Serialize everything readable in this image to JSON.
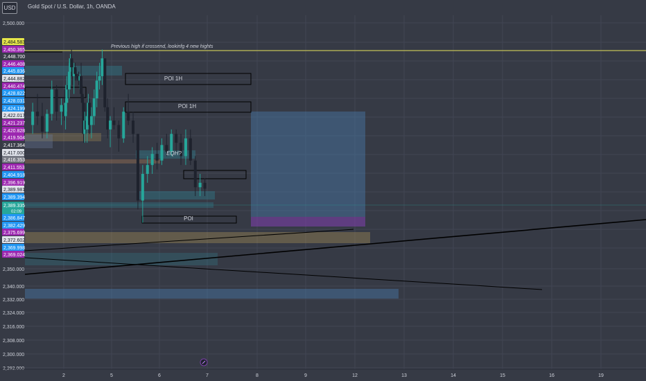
{
  "header": {
    "currency_button": "USD",
    "symbol_title": "Gold Spot / U.S. Dollar, 1h, OANDA"
  },
  "colors": {
    "background": "#363a45",
    "grid": "#414553",
    "candle_up": "#26a69a",
    "candle_down": "#1e222d",
    "hline": "#e5e15a",
    "axis_text": "#d1d4dc"
  },
  "chart_data": {
    "type": "candlestick",
    "symbol": "Gold Spot / U.S. Dollar",
    "interval": "1h",
    "source": "OANDA",
    "grid": true,
    "ylim": [
      2290,
      2506
    ],
    "y_ticks": [
      "2,500.000",
      "2,350.000",
      "2,340.000",
      "2,332.000",
      "2,324.000",
      "2,316.000",
      "2,308.000",
      "2,300.000",
      "2,292.000"
    ],
    "x_ticks": [
      "2",
      "5",
      "6",
      "7",
      "8",
      "9",
      "12",
      "13",
      "14",
      "15",
      "16",
      "19"
    ],
    "price_labels": [
      {
        "text": "2,484.583",
        "price": 2484.583,
        "color": "#e6e64a",
        "dark": true
      },
      {
        "text": "2,450.365",
        "price": 2450.365,
        "color": "#9c27b0"
      },
      {
        "text": "2,448.700",
        "price": 2448.7,
        "color": "#3a3e4a"
      },
      {
        "text": "2,446.408",
        "price": 2446.408,
        "color": "#9c27b0"
      },
      {
        "text": "2,445.836",
        "price": 2445.836,
        "color": "#2196f3"
      },
      {
        "text": "2,444.882",
        "price": 2444.882,
        "color": "#e0e3eb",
        "dark": true
      },
      {
        "text": "2,440.474",
        "price": 2440.474,
        "color": "#9c27b0"
      },
      {
        "text": "2,428.822",
        "price": 2428.822,
        "color": "#2196f3"
      },
      {
        "text": "2,428.031",
        "price": 2428.031,
        "color": "#2196f3"
      },
      {
        "text": "2,424.199",
        "price": 2424.199,
        "color": "#2196f3"
      },
      {
        "text": "2,422.017",
        "price": 2422.017,
        "color": "#e0e3eb",
        "dark": true
      },
      {
        "text": "2,421.237",
        "price": 2421.237,
        "color": "#9c27b0"
      },
      {
        "text": "2,420.828",
        "price": 2420.828,
        "color": "#9c27b0"
      },
      {
        "text": "2,419.504",
        "price": 2419.504,
        "color": "#9c27b0"
      },
      {
        "text": "2,417.364",
        "price": 2417.364,
        "color": "#3a3e4a"
      },
      {
        "text": "2,417.000",
        "price": 2417.0,
        "color": "#e0e3eb",
        "dark": true
      },
      {
        "text": "2,416.353",
        "price": 2416.353,
        "color": "#787b86"
      },
      {
        "text": "2,411.553",
        "price": 2411.553,
        "color": "#9c27b0"
      },
      {
        "text": "2,404.918",
        "price": 2404.918,
        "color": "#2196f3"
      },
      {
        "text": "2,396.919",
        "price": 2396.919,
        "color": "#9c27b0"
      },
      {
        "text": "2,389.981",
        "price": 2389.981,
        "color": "#e0e3eb",
        "dark": true
      },
      {
        "text": "2,389.394",
        "price": 2389.394,
        "color": "#2196f3"
      },
      {
        "text": "2,389.335",
        "price": 2389.335,
        "color": "#26a69a",
        "sub": "02:09"
      },
      {
        "text": "2,386.847",
        "price": 2386.847,
        "color": "#2196f3"
      },
      {
        "text": "2,382.429",
        "price": 2382.429,
        "color": "#2196f3"
      },
      {
        "text": "2,375.699",
        "price": 2375.699,
        "color": "#9c27b0"
      },
      {
        "text": "2,372.602",
        "price": 2372.602,
        "color": "#e0e3eb",
        "dark": true
      },
      {
        "text": "2,369.998",
        "price": 2369.998,
        "color": "#2196f3"
      },
      {
        "text": "2,369.024",
        "price": 2369.024,
        "color": "#9c27b0"
      }
    ],
    "annotations": [
      {
        "text": "Previous high if crossend, lookinfg 4 new hights",
        "price": 2469,
        "x_day": 5.0
      },
      {
        "text": "POI 1H",
        "price": 2443,
        "x_day": 6.1
      },
      {
        "text": "POI 1H",
        "price": 2426,
        "x_day": 6.5
      },
      {
        "text": "EQH?",
        "price": 2417,
        "x_day": 6.3
      },
      {
        "text": "POI",
        "price": 2386,
        "x_day": 6.6
      }
    ],
    "candles": [
      {
        "day": 1.35,
        "o": 2418,
        "h": 2428,
        "l": 2414,
        "c": 2424
      },
      {
        "day": 1.45,
        "o": 2424,
        "h": 2432,
        "l": 2418,
        "c": 2422
      },
      {
        "day": 1.55,
        "o": 2422,
        "h": 2428,
        "l": 2412,
        "c": 2415
      },
      {
        "day": 1.65,
        "o": 2415,
        "h": 2425,
        "l": 2412,
        "c": 2423
      },
      {
        "day": 1.75,
        "o": 2423,
        "h": 2438,
        "l": 2420,
        "c": 2434
      },
      {
        "day": 1.85,
        "o": 2434,
        "h": 2436,
        "l": 2420,
        "c": 2424
      },
      {
        "day": 1.95,
        "o": 2424,
        "h": 2430,
        "l": 2418,
        "c": 2427
      },
      {
        "day": 2.05,
        "o": 2427,
        "h": 2434,
        "l": 2420,
        "c": 2422
      },
      {
        "day": 2.15,
        "o": 2422,
        "h": 2430,
        "l": 2416,
        "c": 2428
      },
      {
        "day": 2.25,
        "o": 2428,
        "h": 2440,
        "l": 2424,
        "c": 2436
      },
      {
        "day": 2.35,
        "o": 2436,
        "h": 2442,
        "l": 2430,
        "c": 2434
      },
      {
        "day": 2.45,
        "o": 2434,
        "h": 2446,
        "l": 2430,
        "c": 2442
      },
      {
        "day": 2.55,
        "o": 2442,
        "h": 2450,
        "l": 2436,
        "c": 2448
      },
      {
        "day": 2.65,
        "o": 2448,
        "h": 2452,
        "l": 2440,
        "c": 2444
      },
      {
        "day": 2.75,
        "o": 2444,
        "h": 2448,
        "l": 2436,
        "c": 2440
      },
      {
        "day": 2.85,
        "o": 2440,
        "h": 2446,
        "l": 2432,
        "c": 2444
      },
      {
        "day": 2.95,
        "o": 2444,
        "h": 2446,
        "l": 2438,
        "c": 2441
      },
      {
        "day": 3.05,
        "o": 2441,
        "h": 2443,
        "l": 2438,
        "c": 2440
      },
      {
        "day": 3.15,
        "o": 2440,
        "h": 2441,
        "l": 2438,
        "c": 2439
      },
      {
        "day": 3.25,
        "o": 2439,
        "h": 2442,
        "l": 2436,
        "c": 2438
      },
      {
        "day": 3.35,
        "o": 2438,
        "h": 2441,
        "l": 2434,
        "c": 2440
      },
      {
        "day": 3.45,
        "o": 2440,
        "h": 2446,
        "l": 2430,
        "c": 2432
      },
      {
        "day": 3.55,
        "o": 2432,
        "h": 2436,
        "l": 2424,
        "c": 2428
      },
      {
        "day": 3.65,
        "o": 2428,
        "h": 2430,
        "l": 2410,
        "c": 2414
      },
      {
        "day": 3.75,
        "o": 2414,
        "h": 2424,
        "l": 2410,
        "c": 2420
      },
      {
        "day": 3.85,
        "o": 2420,
        "h": 2428,
        "l": 2414,
        "c": 2416
      },
      {
        "day": 3.95,
        "o": 2416,
        "h": 2424,
        "l": 2410,
        "c": 2422
      },
      {
        "day": 4.05,
        "o": 2422,
        "h": 2432,
        "l": 2418,
        "c": 2428
      },
      {
        "day": 4.15,
        "o": 2428,
        "h": 2430,
        "l": 2414,
        "c": 2418
      },
      {
        "day": 4.25,
        "o": 2418,
        "h": 2426,
        "l": 2412,
        "c": 2422
      },
      {
        "day": 4.35,
        "o": 2422,
        "h": 2434,
        "l": 2418,
        "c": 2430
      },
      {
        "day": 4.45,
        "o": 2430,
        "h": 2442,
        "l": 2426,
        "c": 2438
      },
      {
        "day": 4.55,
        "o": 2438,
        "h": 2446,
        "l": 2434,
        "c": 2440
      },
      {
        "day": 4.65,
        "o": 2440,
        "h": 2452,
        "l": 2436,
        "c": 2448
      },
      {
        "day": 4.75,
        "o": 2448,
        "h": 2448,
        "l": 2424,
        "c": 2426
      },
      {
        "day": 4.85,
        "o": 2426,
        "h": 2430,
        "l": 2412,
        "c": 2416
      },
      {
        "day": 4.95,
        "o": 2416,
        "h": 2422,
        "l": 2408,
        "c": 2420
      },
      {
        "day": 5.05,
        "o": 2420,
        "h": 2426,
        "l": 2416,
        "c": 2418
      },
      {
        "day": 5.15,
        "o": 2418,
        "h": 2420,
        "l": 2406,
        "c": 2412
      },
      {
        "day": 5.25,
        "o": 2412,
        "h": 2426,
        "l": 2410,
        "c": 2424
      },
      {
        "day": 5.35,
        "o": 2424,
        "h": 2432,
        "l": 2418,
        "c": 2420
      },
      {
        "day": 5.45,
        "o": 2420,
        "h": 2424,
        "l": 2410,
        "c": 2414
      },
      {
        "day": 5.55,
        "o": 2414,
        "h": 2414,
        "l": 2380,
        "c": 2384
      },
      {
        "day": 5.65,
        "o": 2384,
        "h": 2400,
        "l": 2374,
        "c": 2396
      },
      {
        "day": 5.75,
        "o": 2396,
        "h": 2404,
        "l": 2392,
        "c": 2400
      },
      {
        "day": 5.85,
        "o": 2400,
        "h": 2408,
        "l": 2396,
        "c": 2405
      },
      {
        "day": 5.95,
        "o": 2405,
        "h": 2410,
        "l": 2398,
        "c": 2402
      },
      {
        "day": 6.05,
        "o": 2402,
        "h": 2412,
        "l": 2400,
        "c": 2409
      },
      {
        "day": 6.15,
        "o": 2409,
        "h": 2414,
        "l": 2404,
        "c": 2406
      },
      {
        "day": 6.25,
        "o": 2406,
        "h": 2416,
        "l": 2404,
        "c": 2414
      },
      {
        "day": 6.35,
        "o": 2414,
        "h": 2416,
        "l": 2406,
        "c": 2410
      },
      {
        "day": 6.45,
        "o": 2410,
        "h": 2414,
        "l": 2400,
        "c": 2404
      },
      {
        "day": 6.55,
        "o": 2404,
        "h": 2416,
        "l": 2400,
        "c": 2412
      },
      {
        "day": 6.65,
        "o": 2412,
        "h": 2416,
        "l": 2400,
        "c": 2402
      },
      {
        "day": 6.75,
        "o": 2402,
        "h": 2404,
        "l": 2386,
        "c": 2390
      },
      {
        "day": 6.85,
        "o": 2390,
        "h": 2396,
        "l": 2386,
        "c": 2392
      },
      {
        "day": 6.95,
        "o": 2392,
        "h": 2394,
        "l": 2386,
        "c": 2389.335
      }
    ]
  }
}
